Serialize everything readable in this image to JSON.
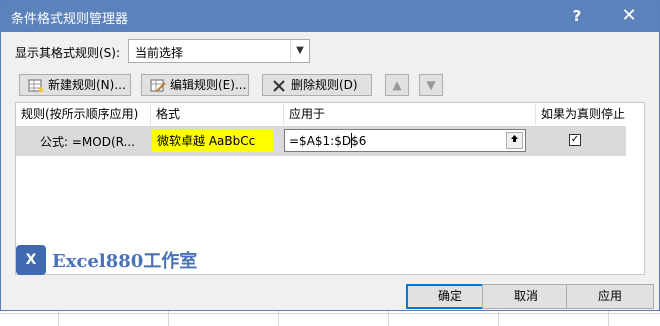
{
  "window": {
    "title": "条件格式规则管理器",
    "help_glyph": "?",
    "close_glyph": "✕"
  },
  "scope": {
    "label": "显示其格式规则(S):",
    "selected": "当前选择"
  },
  "toolbar": {
    "new_rule": "新建规则(N)...",
    "edit_rule": "编辑规则(E)...",
    "delete_rule": "删除规则(D)",
    "move_up": "▲",
    "move_down": "▼"
  },
  "grid": {
    "headers": {
      "rule": "规则(按所示顺序应用)",
      "format": "格式",
      "applies_to": "应用于",
      "stop_if_true": "如果为真则停止"
    },
    "rows": [
      {
        "rule": "公式: =MOD(R...",
        "format_preview": "微软卓越  AaBbCc",
        "applies_to": "=$A$1:$D$6",
        "stop_if_true": true
      }
    ]
  },
  "watermark": {
    "logo": "X",
    "text": "Excel880工作室"
  },
  "footer": {
    "ok": "确定",
    "cancel": "取消",
    "apply": "应用"
  },
  "colors": {
    "titlebar": "#5b82bb",
    "selected_row": "#dadada",
    "format_preview_bg": "#ffff00",
    "watermark": "#4a72b8"
  }
}
